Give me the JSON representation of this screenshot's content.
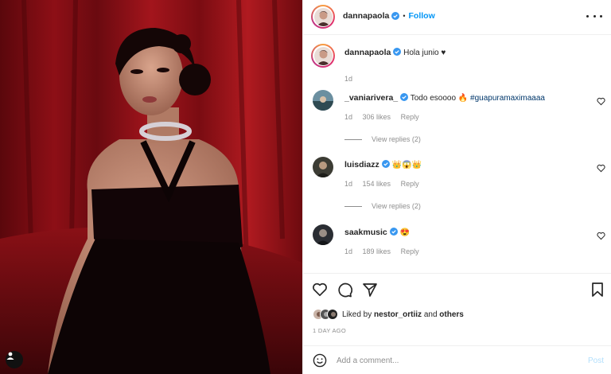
{
  "post": {
    "author": "dannapaola",
    "follow_label": "Follow",
    "dot": "•",
    "caption": "Hola junio ♥",
    "caption_time": "1d",
    "more_icon": "more-horizontal-icon"
  },
  "comments": [
    {
      "username": "_vaniarivera_",
      "verified": true,
      "text": "Todo esoooo 🔥",
      "hashtag": "#guapuramaximaaaa",
      "time": "1d",
      "likes": "306 likes",
      "reply_label": "Reply",
      "view_replies": "View replies (2)"
    },
    {
      "username": "luisdiazz",
      "verified": true,
      "text": "👑😱👑",
      "time": "1d",
      "likes": "154 likes",
      "reply_label": "Reply",
      "view_replies": "View replies (2)"
    },
    {
      "username": "saakmusic",
      "verified": true,
      "text": "😍",
      "time": "1d",
      "likes": "189 likes",
      "reply_label": "Reply"
    }
  ],
  "likes": {
    "prefix": "Liked by",
    "user": "nestor_ortiiz",
    "conjunction": "and",
    "others": "others"
  },
  "date": "1 DAY AGO",
  "add_comment": {
    "placeholder": "Add a comment...",
    "post_label": "Post"
  },
  "colors": {
    "accent": "#0095f6",
    "verified": "#3897f0",
    "hashtag": "#00376b",
    "muted": "#8e8e8e",
    "post_disabled": "#b2dffc"
  }
}
